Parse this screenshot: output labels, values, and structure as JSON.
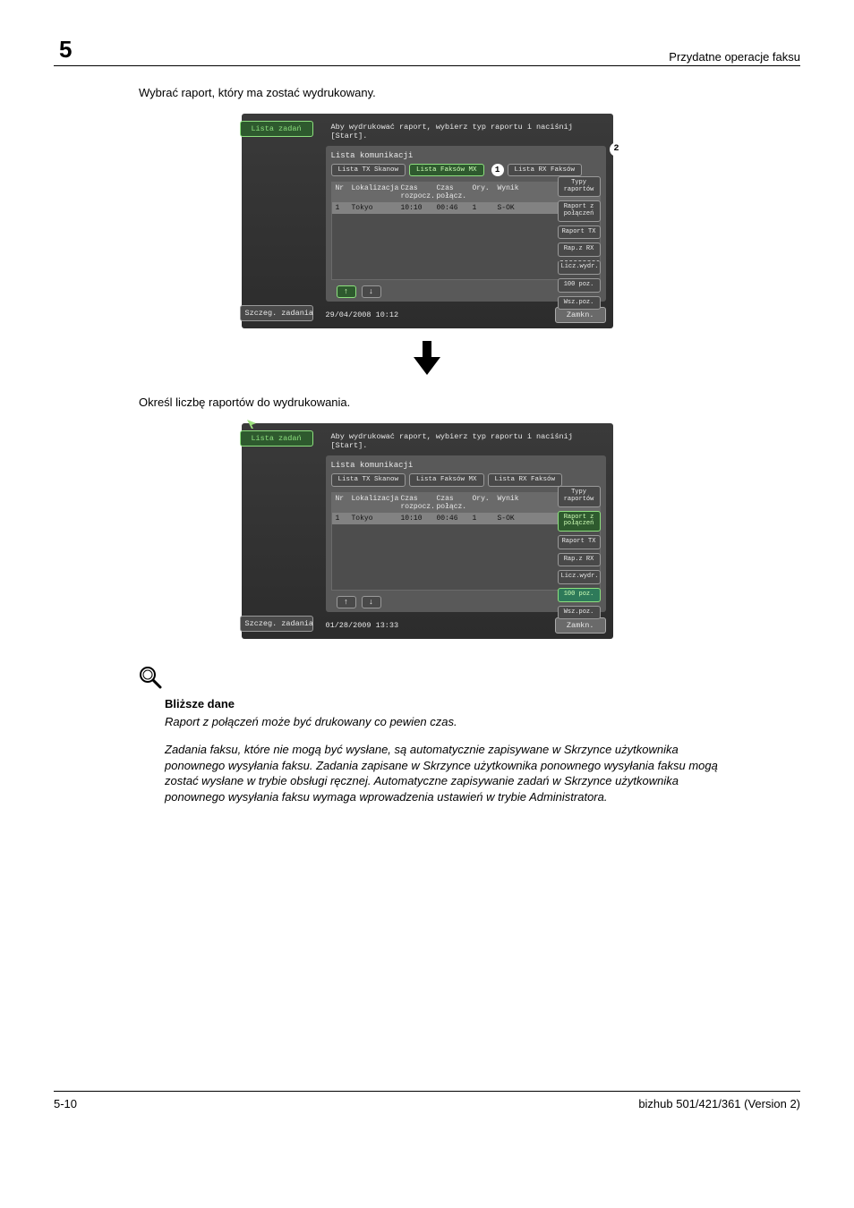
{
  "header": {
    "chapter": "5",
    "title": "Przydatne operacje faksu"
  },
  "step1_text": "Wybrać raport, który ma zostać wydrukowany.",
  "step2_text": "Określ liczbę raportów do wydrukowania.",
  "section": {
    "title": "Bliższe dane",
    "para1": "Raport z połączeń może być drukowany co pewien czas.",
    "para2": "Zadania faksu, które nie mogą być wysłane, są automatycznie zapisywane w Skrzynce użytkownika ponownego wysyłania faksu. Zadania zapisane w Skrzynce użytkownika ponownego wysyłania faksu mogą zostać wysłane w trybie obsługi ręcznej. Automatyczne zapisywanie zadań w Skrzynce użytkownika ponownego wysyłania faksu wymaga wprowadzenia ustawień w trybie Administratora."
  },
  "footer": {
    "page": "5-10",
    "product": "bizhub 501/421/361 (Version 2)"
  },
  "callouts": {
    "one": "1",
    "two": "2"
  },
  "screen_common": {
    "left_top": "Lista zadań",
    "left_bottom": "Szczeg. zadania",
    "instruction": "Aby wydrukować raport, wybierz typ raportu i naciśnij [Start].",
    "panel_title": "Lista komunikacji",
    "tabs": {
      "tx": "Lista TX\nSkanow",
      "mx": "Lista\nFaksów MX",
      "rx": "Lista RX\nFaksów"
    },
    "columns": {
      "nr": "Nr",
      "lok": "Lokalizacja",
      "czas1": "Czas\nrozpocz.",
      "czas2": "Czas\npołącz.",
      "ory": "Ory.",
      "wyn": "Wynik"
    },
    "row": {
      "nr": "1",
      "lok": "Tokyo",
      "czas1": "10:10",
      "czas2": "00:46",
      "ory": "1",
      "wyn": "S-OK"
    },
    "right": {
      "typy": "Typy\nraportów",
      "raport_pol": "Raport z\npołączeń",
      "raport_tx": "Raport TX",
      "rap_rx": "Rap.z RX",
      "licz": "Licz.wydr.",
      "poz100": "100 poz.",
      "wsz": "Wsz.poz."
    },
    "close": "Zamkn."
  },
  "screen1": {
    "datetime": "29/04/2008   10:12"
  },
  "screen2": {
    "datetime": "01/28/2009   13:33"
  }
}
